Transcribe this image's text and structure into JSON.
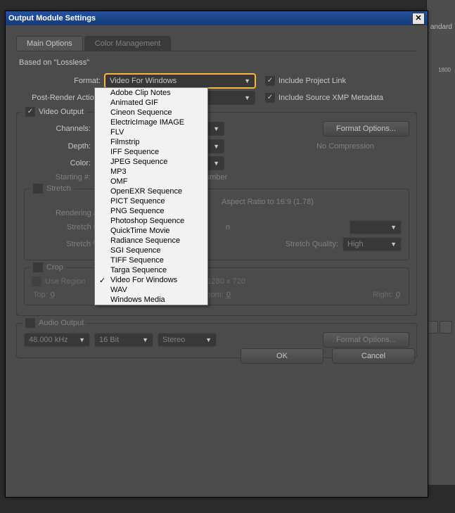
{
  "dialog": {
    "title": "Output Module Settings",
    "based_on": "Based on \"Lossless\"",
    "tabs": {
      "main": "Main Options",
      "color": "Color Management"
    },
    "format": {
      "label": "Format:",
      "value": "Video For Windows",
      "include_project_link": "Include Project Link"
    },
    "post_render": {
      "label": "Post-Render Action:",
      "include_xmp": "Include Source XMP Metadata"
    },
    "video_output": {
      "header": "Video Output",
      "channels_label": "Channels:",
      "depth_label": "Depth:",
      "color_label": "Color:",
      "starting_label": "Starting #:",
      "format_options_btn": "Format Options...",
      "no_compression": "No Compression",
      "frame_number_hint": "e Number"
    },
    "stretch": {
      "header": "Stretch",
      "lock_aspect": "Aspect Ratio to 16:9 (1.78)",
      "rendering_at_label": "Rendering at:",
      "stretch_to_label": "Stretch to:",
      "stretch_to_suffix": "n",
      "stretch_pct_label": "Stretch %:",
      "quality_label": "Stretch Quality:",
      "quality_value": "High"
    },
    "crop": {
      "header": "Crop",
      "use_region_label": "Use Region",
      "final_size": "l Size: 1280 x 720",
      "top_label": "Top:",
      "top_val": "0",
      "bottom_label": "Bottom:",
      "bottom_val": "0",
      "right_label": "Right:",
      "right_val": "0"
    },
    "audio_output": {
      "header": "Audio Output",
      "sample_rate": "48.000 kHz",
      "depth": "16 Bit",
      "channels": "Stereo",
      "format_options_btn": "Format Options..."
    },
    "buttons": {
      "ok": "OK",
      "cancel": "Cancel"
    }
  },
  "format_options": [
    "Adobe Clip Notes",
    "Animated GIF",
    "Cineon Sequence",
    "ElectricImage IMAGE",
    "FLV",
    "Filmstrip",
    "IFF Sequence",
    "JPEG Sequence",
    "MP3",
    "OMF",
    "OpenEXR Sequence",
    "PICT Sequence",
    "PNG Sequence",
    "Photoshop Sequence",
    "QuickTime Movie",
    "Radiance Sequence",
    "SGI Sequence",
    "TIFF Sequence",
    "Targa Sequence",
    "Video For Windows",
    "WAV",
    "Windows Media"
  ],
  "format_selected_index": 19,
  "backdrop": {
    "standard_label": "andard",
    "ruler_tick": "1800"
  }
}
